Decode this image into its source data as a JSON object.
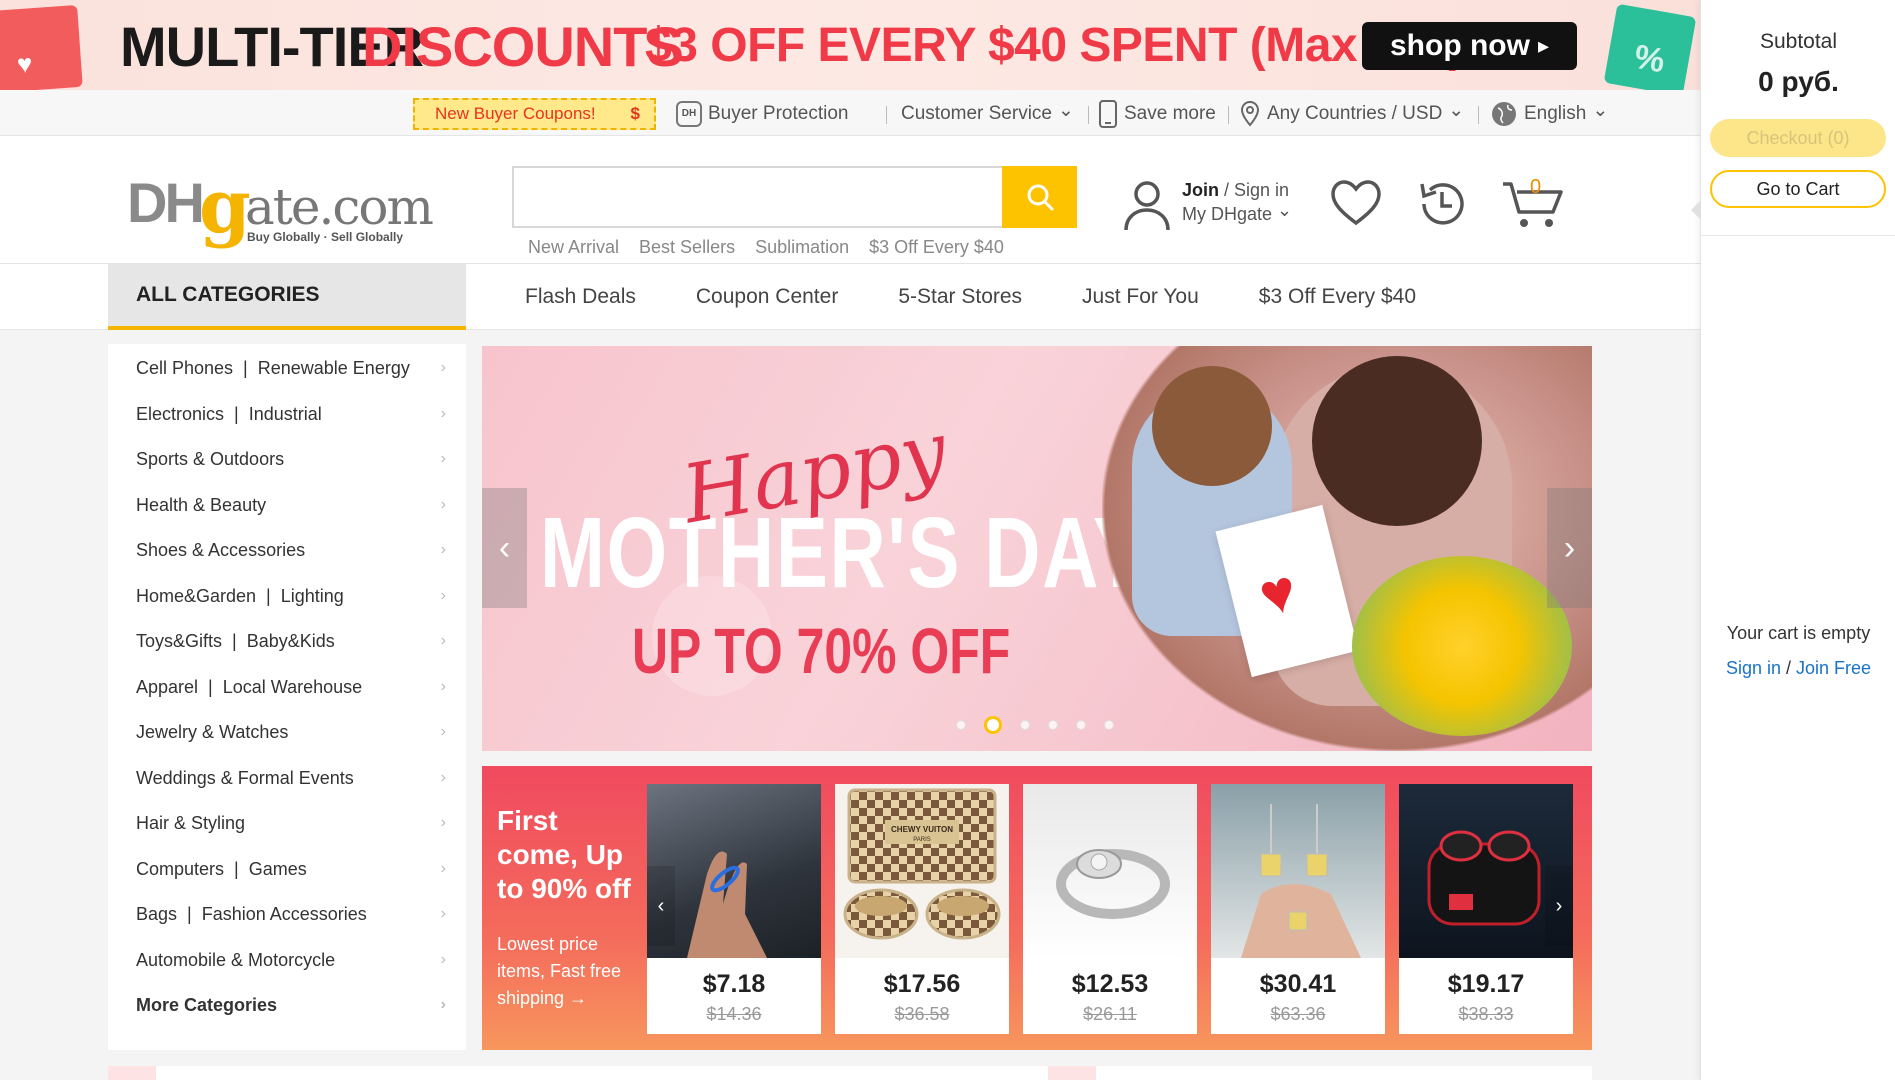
{
  "promo": {
    "t1": "MULTI-TIER",
    "t2": "DISCOUNTS",
    "t3": "$3 OFF EVERY $40 SPENT (Max $30)",
    "shop_now": "shop now",
    "shop_arrow": "▸"
  },
  "utilbar": {
    "coupon": "New Buyer Coupons!",
    "coupon_symbol": "$",
    "buyer_protection": "Buyer Protection",
    "dh_badge": "DH",
    "customer_service": "Customer Service",
    "save_more": "Save more",
    "countries": "Any Countries / USD",
    "language": "English",
    "chevron": "⌄"
  },
  "header": {
    "logo": {
      "dh": "DH",
      "g": "g",
      "ate": "ate.com",
      "tagline": "Buy Globally · Sell Globally"
    },
    "search_placeholder": "",
    "hotwords": [
      "New Arrival",
      "Best Sellers",
      "Sublimation",
      "$3 Off Every $40"
    ],
    "account": {
      "join": "Join",
      "sep": " / ",
      "signin": "Sign in",
      "my": "My DHgate"
    },
    "cart_count": "0"
  },
  "nav": {
    "all_categories": "ALL CATEGORIES",
    "links": [
      "Flash Deals",
      "Coupon Center",
      "5-Star Stores",
      "Just For You",
      "$3 Off Every $40"
    ]
  },
  "categories": [
    "Cell Phones  |  Renewable Energy",
    "Electronics  |  Industrial",
    "Sports & Outdoors",
    "Health & Beauty",
    "Shoes & Accessories",
    "Home&Garden  |  Lighting",
    "Toys&Gifts  |  Baby&Kids",
    "Apparel  |  Local Warehouse",
    "Jewelry & Watches",
    "Weddings & Formal Events",
    "Hair & Styling",
    "Computers  |  Games",
    "Bags  |  Fashion Accessories",
    "Automobile & Motorcycle",
    "More Categories"
  ],
  "carousel": {
    "happy": "Happy",
    "title": "MOTHER'S DAY",
    "subtitle": "UP TO 70% OFF",
    "prev": "‹",
    "next": "›",
    "slide_count": 6,
    "active_slide": 2
  },
  "deals": {
    "headline": "First come, Up to 90% off",
    "subline": "Lowest price items, Fast free shipping →",
    "prev": "‹",
    "next": "›",
    "products": [
      {
        "name": "ring",
        "price": "$7.18",
        "old": "$14.36"
      },
      {
        "name": "pet-bowls",
        "price": "$17.56",
        "old": "$36.58"
      },
      {
        "name": "silver-ring",
        "price": "$12.53",
        "old": "$26.11"
      },
      {
        "name": "earrings",
        "price": "$30.41",
        "old": "$63.36"
      },
      {
        "name": "earbuds",
        "price": "$19.17",
        "old": "$38.33"
      }
    ],
    "bowl_label": "CHEWY VUITON\nPARIS"
  },
  "cart": {
    "subtotal_label": "Subtotal",
    "subtotal_value": "0 руб.",
    "checkout": "Checkout (0)",
    "go_to_cart": "Go to Cart",
    "empty": "Your cart is empty",
    "sign_in": "Sign in",
    "sep": " / ",
    "join_free": "Join Free"
  },
  "colors": {
    "accent_yellow": "#fdc300",
    "promo_red": "#f03a47",
    "link_blue": "#1a73c9",
    "deals_red": "#f04a5e"
  }
}
